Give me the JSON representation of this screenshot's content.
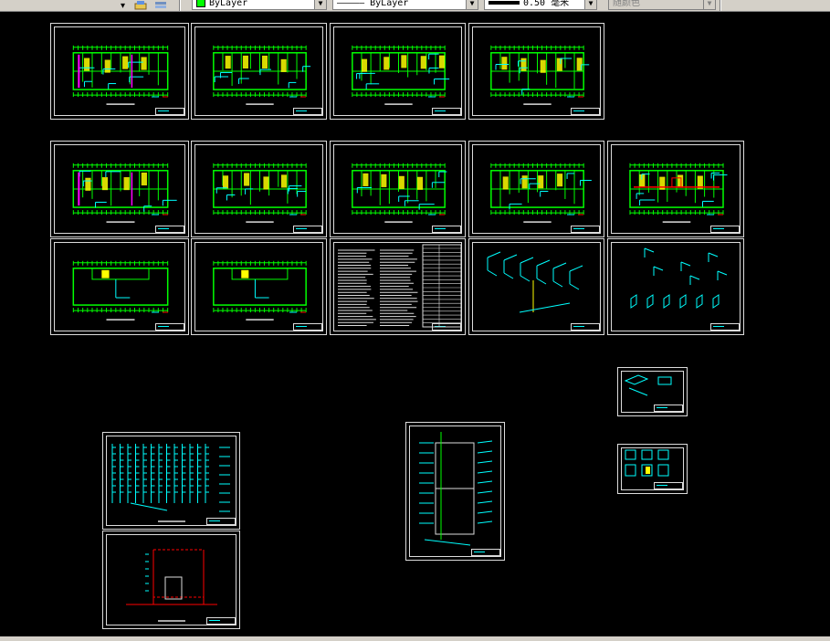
{
  "toolbar": {
    "layer_value": "ByLayer",
    "linetype_value": "ByLayer",
    "lineweight_value": "0.50 毫米",
    "plotstyle_value": "随颜色",
    "linetype_preview": "—————"
  },
  "colors": {
    "background": "#000000",
    "wall_green": "#00ff00",
    "pipe_cyan": "#00ffff",
    "room_yellow": "#ffff00",
    "accent_magenta": "#ff00ff",
    "accent_red": "#ff0000",
    "frame": "#dcdcdc"
  },
  "sheets": [
    {
      "id": "plan-01",
      "kind": "floor-plan-magenta"
    },
    {
      "id": "plan-02",
      "kind": "floor-plan"
    },
    {
      "id": "plan-03",
      "kind": "floor-plan-yellow"
    },
    {
      "id": "plan-04",
      "kind": "floor-plan-yellow"
    },
    {
      "id": "plan-05",
      "kind": "floor-plan-magenta"
    },
    {
      "id": "plan-06",
      "kind": "floor-plan"
    },
    {
      "id": "plan-07",
      "kind": "floor-plan-cyan"
    },
    {
      "id": "plan-08",
      "kind": "floor-plan-cyan"
    },
    {
      "id": "plan-09",
      "kind": "floor-plan-red"
    },
    {
      "id": "plan-10",
      "kind": "roof-plan"
    },
    {
      "id": "plan-11",
      "kind": "roof-plan"
    },
    {
      "id": "notes-12",
      "kind": "notes"
    },
    {
      "id": "iso-13",
      "kind": "isometric"
    },
    {
      "id": "iso-14",
      "kind": "isometric-small"
    },
    {
      "id": "detail-15",
      "kind": "detail"
    },
    {
      "id": "detail-16",
      "kind": "detail-boxes"
    },
    {
      "id": "riser-17",
      "kind": "riser"
    },
    {
      "id": "riser-18",
      "kind": "riser-red"
    },
    {
      "id": "riser-19",
      "kind": "riser-tall"
    }
  ]
}
